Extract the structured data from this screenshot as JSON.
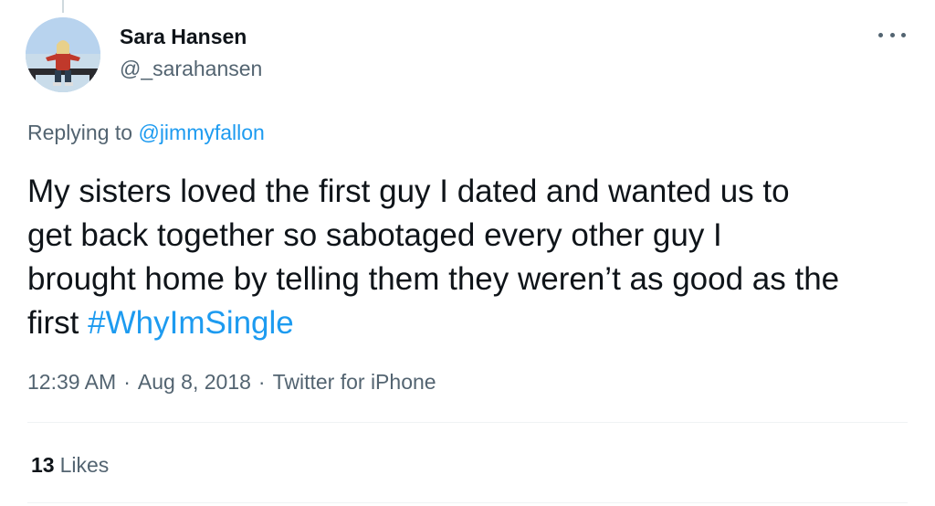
{
  "author": {
    "display_name": "Sara Hansen",
    "handle": "@_sarahansen"
  },
  "reply": {
    "prefix": "Replying to",
    "mention": "@jimmyfallon"
  },
  "tweet": {
    "lines": [
      "My sisters loved the first guy I dated and wanted us to",
      "get back together so sabotaged every other guy I",
      "brought home by telling them they weren’t as good as the",
      "first"
    ],
    "hashtag": "#WhyImSingle"
  },
  "meta": {
    "time": "12:39 AM",
    "date": "Aug 8, 2018",
    "source": "Twitter for iPhone",
    "separator": "·"
  },
  "stats": {
    "likes_count": "13",
    "likes_label": "Likes"
  },
  "colors": {
    "link": "#1d9bf0",
    "secondary_text": "#536471",
    "primary_text": "#0f1419",
    "divider": "#eff3f4"
  },
  "icons": {
    "more": "more-horizontal-icon"
  }
}
